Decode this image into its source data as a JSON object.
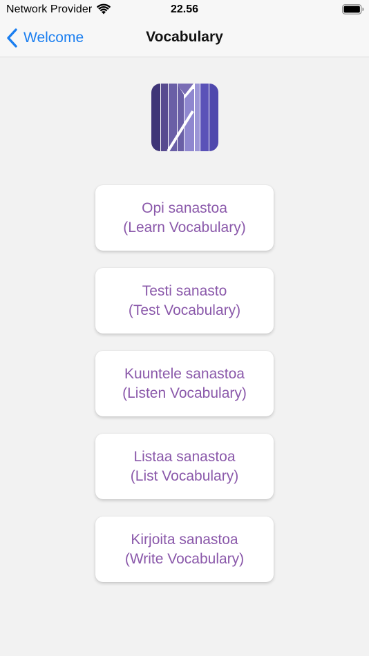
{
  "status_bar": {
    "carrier": "Network Provider",
    "time": "22.56"
  },
  "nav": {
    "back_label": "Welcome",
    "title": "Vocabulary"
  },
  "colors": {
    "accent_blue": "#1a7ef0",
    "button_text": "#8a58aa",
    "logo_dark": "#43387a",
    "logo_light": "#a9a2dc"
  },
  "menu": {
    "items": [
      {
        "line1": "Opi sanastoa",
        "line2": "(Learn Vocabulary)"
      },
      {
        "line1": "Testi sanasto",
        "line2": "(Test Vocabulary)"
      },
      {
        "line1": "Kuuntele sanastoa",
        "line2": "(Listen Vocabulary)"
      },
      {
        "line1": "Listaa sanastoa",
        "line2": "(List Vocabulary)"
      },
      {
        "line1": "Kirjoita sanastoa",
        "line2": "(Write Vocabulary)"
      }
    ]
  }
}
